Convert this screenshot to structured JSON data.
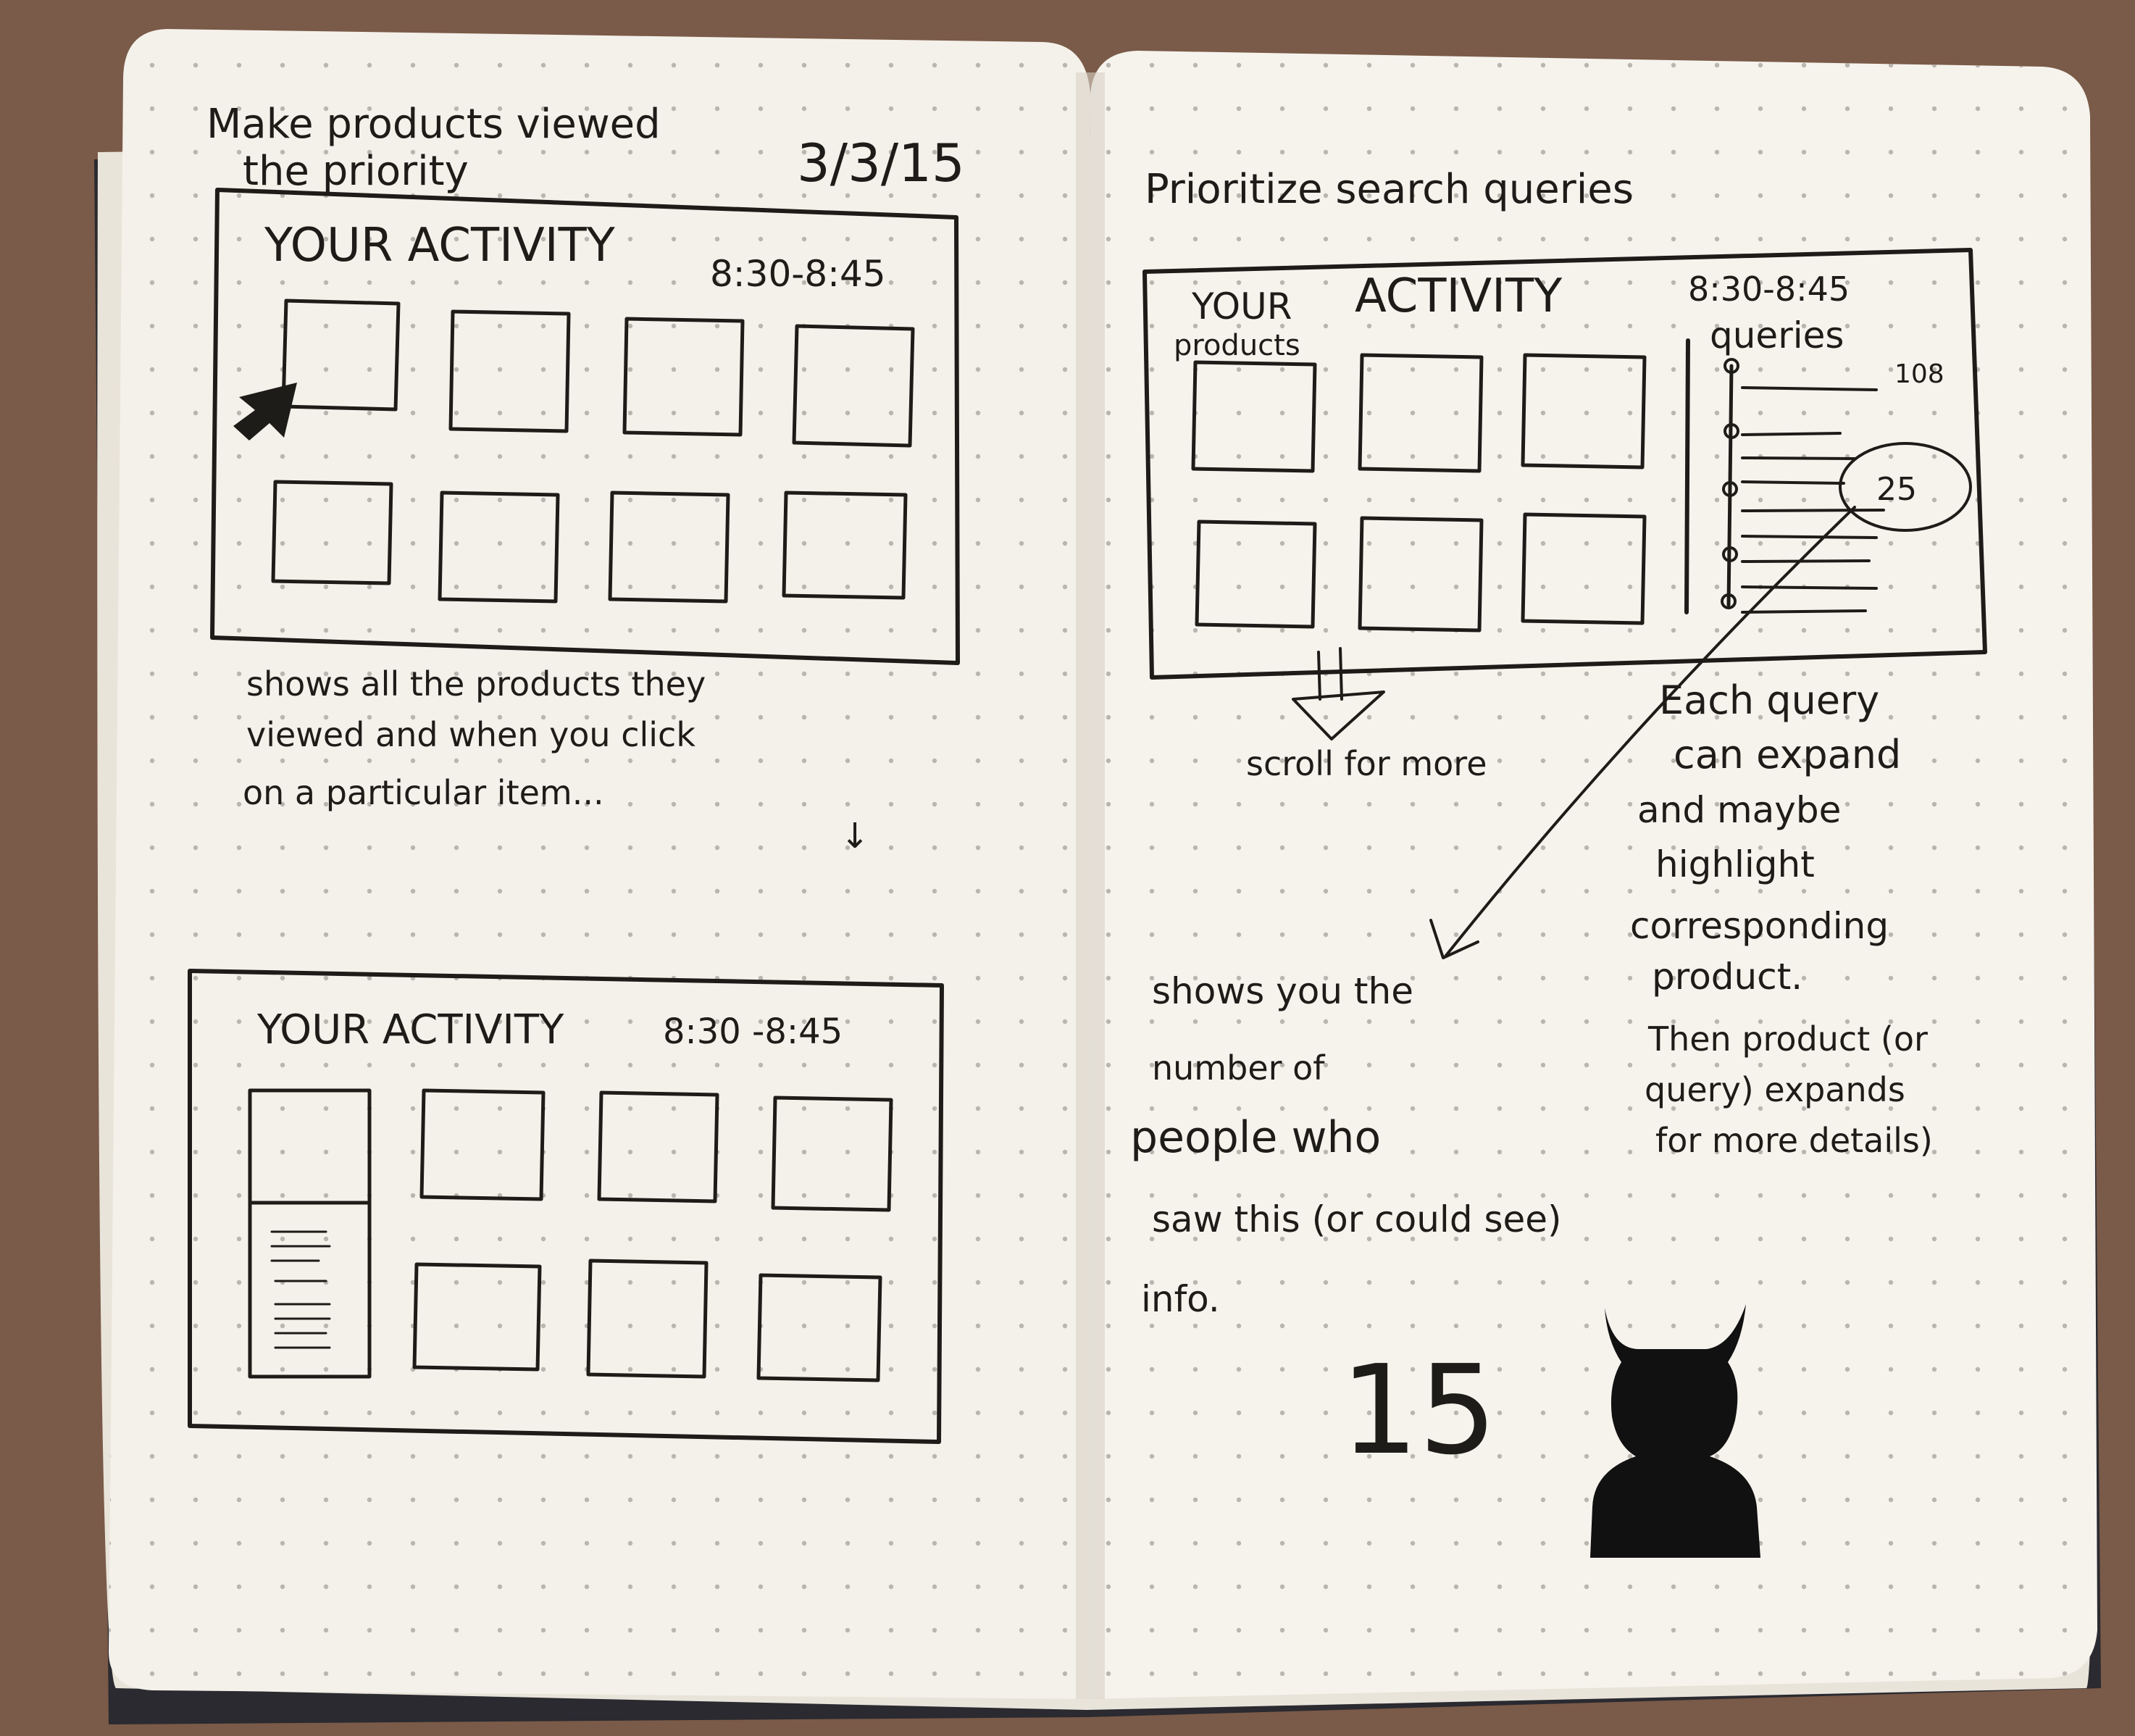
{
  "colors": {
    "background": "#7a5a48",
    "paper": "#f4f1ea",
    "ink": "#1e1c18",
    "dots": "#b9b6af"
  },
  "left_page": {
    "heading": [
      "Make products viewed",
      "the priority"
    ],
    "date": "3/3/15",
    "sketch_top": {
      "title": "YOUR ACTIVITY",
      "time": "8:30-8:45",
      "pointer_icon": "cursor-arrow-icon"
    },
    "note": [
      "shows all the products they",
      "viewed and when you click",
      "on a particular item..."
    ],
    "note_arrow": "↓",
    "sketch_bottom": {
      "title": "YOUR ACTIVITY",
      "time": "8:30 -8:45"
    }
  },
  "right_page": {
    "heading": "Prioritize search queries",
    "sketch": {
      "title": "ACTIVITY",
      "title_prefix": "YOUR",
      "products_label": "products",
      "time": "8:30-8:45",
      "queries_label": "queries",
      "query_count_top": "108",
      "query_count_circled": "25"
    },
    "scroll_note": "scroll for more",
    "expand_note": [
      "Each query",
      "can expand",
      "and maybe",
      "highlight",
      "corresponding",
      "product.",
      "Then product (or",
      "query) expands",
      "for more details)"
    ],
    "people_note": [
      "shows you the",
      "number of",
      "people who",
      "saw this (or could see)",
      "info."
    ],
    "viewer_count": "15",
    "viewer_icon": "horned-person-icon"
  }
}
